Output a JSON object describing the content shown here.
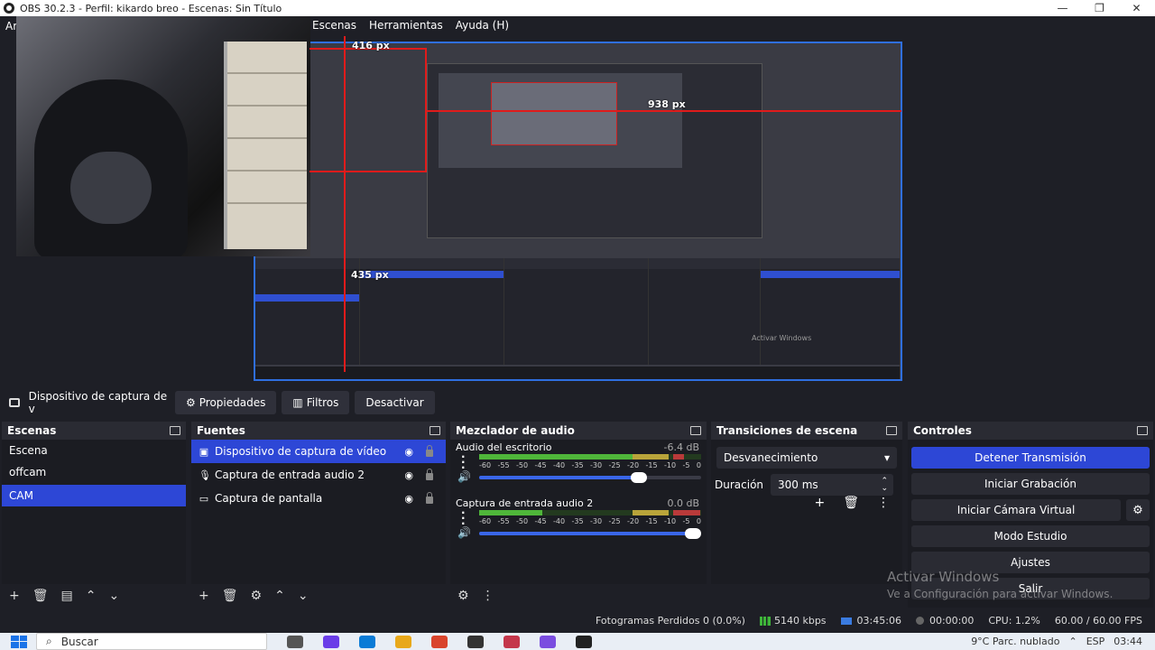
{
  "window": {
    "title": "OBS 30.2.3 - Perfil: kikardo breo - Escenas: Sin Título",
    "controls": [
      "—",
      "❐",
      "✕"
    ]
  },
  "menu": {
    "items": [
      "Ar",
      "Escenas",
      "Herramientas",
      "Ayuda (H)"
    ]
  },
  "preview": {
    "measure_top": "416 px",
    "measure_right": "938 px",
    "measure_left": "435 px",
    "nested_watermark": "Activar Windows"
  },
  "source_toolbar": {
    "device": "Dispositivo de captura de v",
    "properties": "Propiedades",
    "filters": "Filtros",
    "deactivate": "Desactivar"
  },
  "scenes": {
    "title": "Escenas",
    "items": [
      "Escena",
      "offcam",
      "CAM"
    ],
    "active_index": 2
  },
  "sources": {
    "title": "Fuentes",
    "items": [
      {
        "label": "Dispositivo de captura de vídeo",
        "icon": "camera-icon"
      },
      {
        "label": "Captura de entrada audio 2",
        "icon": "microphone-icon"
      },
      {
        "label": "Captura de pantalla",
        "icon": "monitor-icon"
      }
    ]
  },
  "mixer": {
    "title": "Mezclador de audio",
    "scale": [
      "-60",
      "-55",
      "-50",
      "-45",
      "-40",
      "-35",
      "-30",
      "-25",
      "-20",
      "-15",
      "-10",
      "-5",
      "0"
    ],
    "channels": [
      {
        "name": "Audio del escritorio",
        "db": "-6.4 dB",
        "level": 0.72,
        "volume": 0.72
      },
      {
        "name": "Captura de entrada audio 2",
        "db": "0.0 dB",
        "level": 0.3,
        "volume": 0.95
      }
    ]
  },
  "transitions": {
    "title": "Transiciones de escena",
    "selected": "Desvanecimiento",
    "duration_label": "Duración",
    "duration_value": "300 ms"
  },
  "controls": {
    "title": "Controles",
    "stop_stream": "Detener Transmisión",
    "start_record": "Iniciar Grabación",
    "virtual_cam": "Iniciar Cámara Virtual",
    "studio_mode": "Modo Estudio",
    "settings": "Ajustes",
    "exit": "Salir"
  },
  "watermark": {
    "line1": "Activar Windows",
    "line2": "Ve a Configuración para activar Windows."
  },
  "status": {
    "dropped": "Fotogramas Perdidos 0 (0.0%)",
    "bitrate": "5140 kbps",
    "stream_time": "03:45:06",
    "rec_time": "00:00:00",
    "cpu": "CPU: 1.2%",
    "fps": "60.00 / 60.00 FPS"
  },
  "taskbar": {
    "search": "Buscar",
    "weather": "9°C Parc. nublado",
    "lang": "ESP",
    "time": "03:44"
  },
  "colors": {
    "accent": "#2d47d6",
    "guides": "#e01b1b",
    "meter_green": "#4fb63a"
  }
}
